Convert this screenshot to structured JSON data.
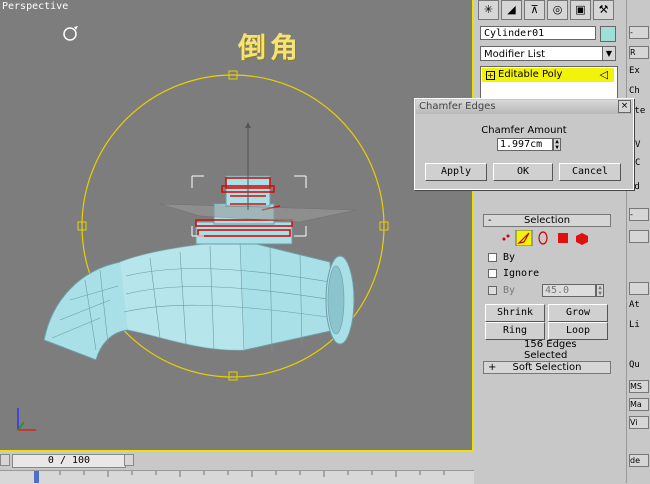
{
  "viewport": {
    "label": "Perspective",
    "title_text": "倒角",
    "colors": {
      "background": "#7d7d7d",
      "border": "#f0e000",
      "object": "#a9dfe6",
      "selected_edges": "#d01010",
      "gizmo": "#e8d000"
    }
  },
  "timeline": {
    "frame_display": "0 / 100"
  },
  "command_panel": {
    "toolbar_icons": [
      "create-icon",
      "modify-icon",
      "hierarchy-icon",
      "motion-icon",
      "display-icon",
      "utilities-icon"
    ],
    "object_name": "Cylinder01",
    "object_color": "#9fe0d6",
    "modifier_list_label": "Modifier List",
    "stack_item": "Editable Poly"
  },
  "dialog": {
    "title": "Chamfer Edges",
    "amount_label": "Chamfer Amount",
    "amount_value": "1.997cm",
    "apply_label": "Apply",
    "ok_label": "OK",
    "cancel_label": "Cancel"
  },
  "selection_rollout": {
    "title": "Selection",
    "by_vertex_label": "By",
    "ignore_backfacing_label": "Ignore",
    "by_angle_label": "By",
    "angle_value": "45.0",
    "shrink_label": "Shrink",
    "grow_label": "Grow",
    "ring_label": "Ring",
    "loop_label": "Loop",
    "status": "156 Edges Selected"
  },
  "soft_selection_rollout": {
    "title": "Soft Selection"
  },
  "right_strip": {
    "items": [
      "-",
      "R",
      "Ex",
      "Ch",
      "ate",
      "V",
      "C",
      "Ed",
      "-",
      "At",
      "Li",
      "Qu",
      "MS",
      "Ma",
      "Vi",
      "de"
    ]
  }
}
